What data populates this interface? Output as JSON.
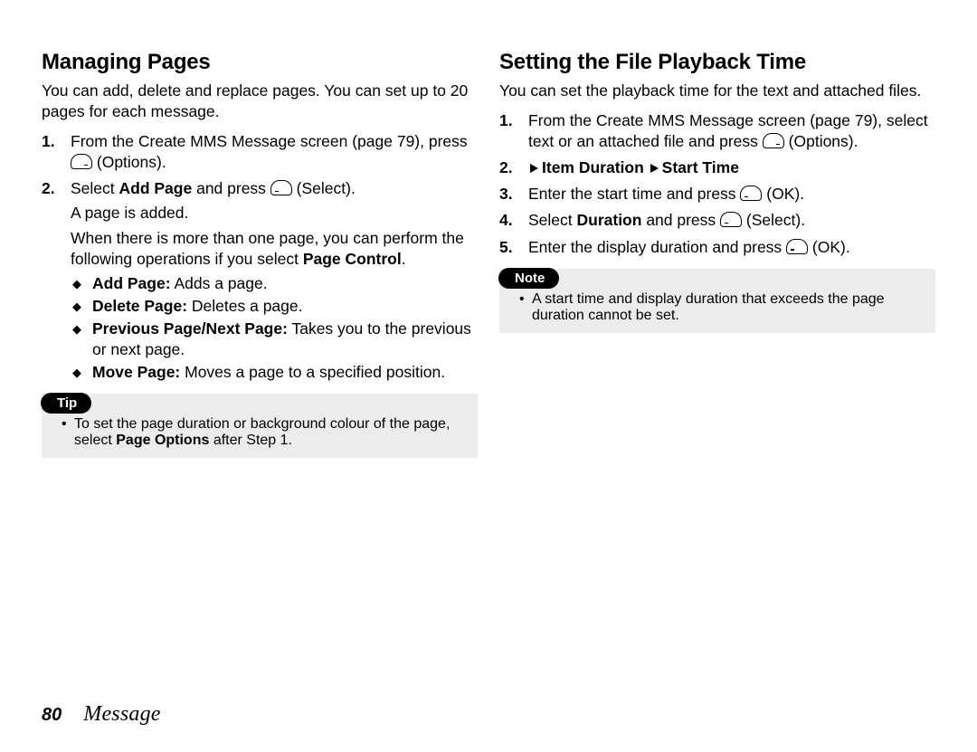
{
  "left": {
    "title": "Managing Pages",
    "intro": "You can add, delete and replace pages. You can set up to 20 pages for each message.",
    "step1_a": "From the Create MMS Message screen (page 79), press ",
    "step1_b": " (Options).",
    "step2_a": "Select ",
    "step2_bold": "Add Page",
    "step2_b": " and press ",
    "step2_c": " (Select).",
    "added": "A page is added.",
    "para2_a": "When there is more than one page, you can perform the following operations if you select ",
    "para2_bold": "Page Control",
    "para2_b": ".",
    "d1_b": "Add Page:",
    "d1_t": " Adds a page.",
    "d2_b": "Delete Page:",
    "d2_t": " Deletes a page.",
    "d3_b": "Previous Page/Next Page:",
    "d3_t": " Takes you to the previous or next page.",
    "d4_b": "Move Page:",
    "d4_t": " Moves a page to a specified position.",
    "tip_label": "Tip",
    "tip_a": "To set the page duration or background colour of the page, select ",
    "tip_bold": "Page Options",
    "tip_b": " after Step 1."
  },
  "right": {
    "title": "Setting the File Playback Time",
    "intro": "You can set the playback time for the text and attached files.",
    "step1_a": "From the Create MMS Message screen (page 79), select text or an attached file and press ",
    "step1_b": " (Options).",
    "nav1": "Item Duration",
    "nav2": "Start Time",
    "step3_a": "Enter the start time and press ",
    "step3_b": " (OK).",
    "step4_a": "Select ",
    "step4_bold": "Duration",
    "step4_b": " and press ",
    "step4_c": " (Select).",
    "step5_a": "Enter the display duration and press ",
    "step5_b": " (OK).",
    "note_label": "Note",
    "note_text": "A start time and display duration that exceeds the page duration cannot be set."
  },
  "footer": {
    "page": "80",
    "section": "Message"
  }
}
